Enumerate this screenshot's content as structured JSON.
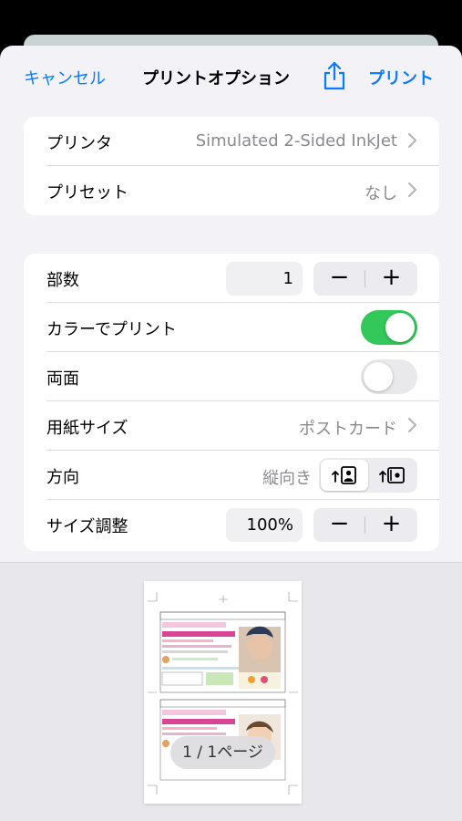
{
  "navbar": {
    "cancel_label": "キャンセル",
    "title": "プリントオプション",
    "share_icon": "share-icon",
    "print_label": "プリント"
  },
  "printer_group": {
    "printer": {
      "label": "プリンタ",
      "value": "Simulated 2-Sided InkJet"
    },
    "preset": {
      "label": "プリセット",
      "value": "なし"
    }
  },
  "options_group": {
    "copies": {
      "label": "部数",
      "value": "1",
      "minus": "−",
      "plus": "+"
    },
    "color": {
      "label": "カラーでプリント",
      "on": true
    },
    "duplex": {
      "label": "両面",
      "on": false
    },
    "paper_size": {
      "label": "用紙サイズ",
      "value": "ポストカード"
    },
    "orientation": {
      "label": "方向",
      "value": "縦向き",
      "selected": "portrait"
    },
    "scaling": {
      "label": "サイズ調整",
      "value": "100%",
      "minus": "−",
      "plus": "+"
    }
  },
  "preview": {
    "page_indicator": "1 / 1ページ"
  },
  "colors": {
    "accent": "#0a7aff",
    "toggle_on": "#34c759"
  }
}
